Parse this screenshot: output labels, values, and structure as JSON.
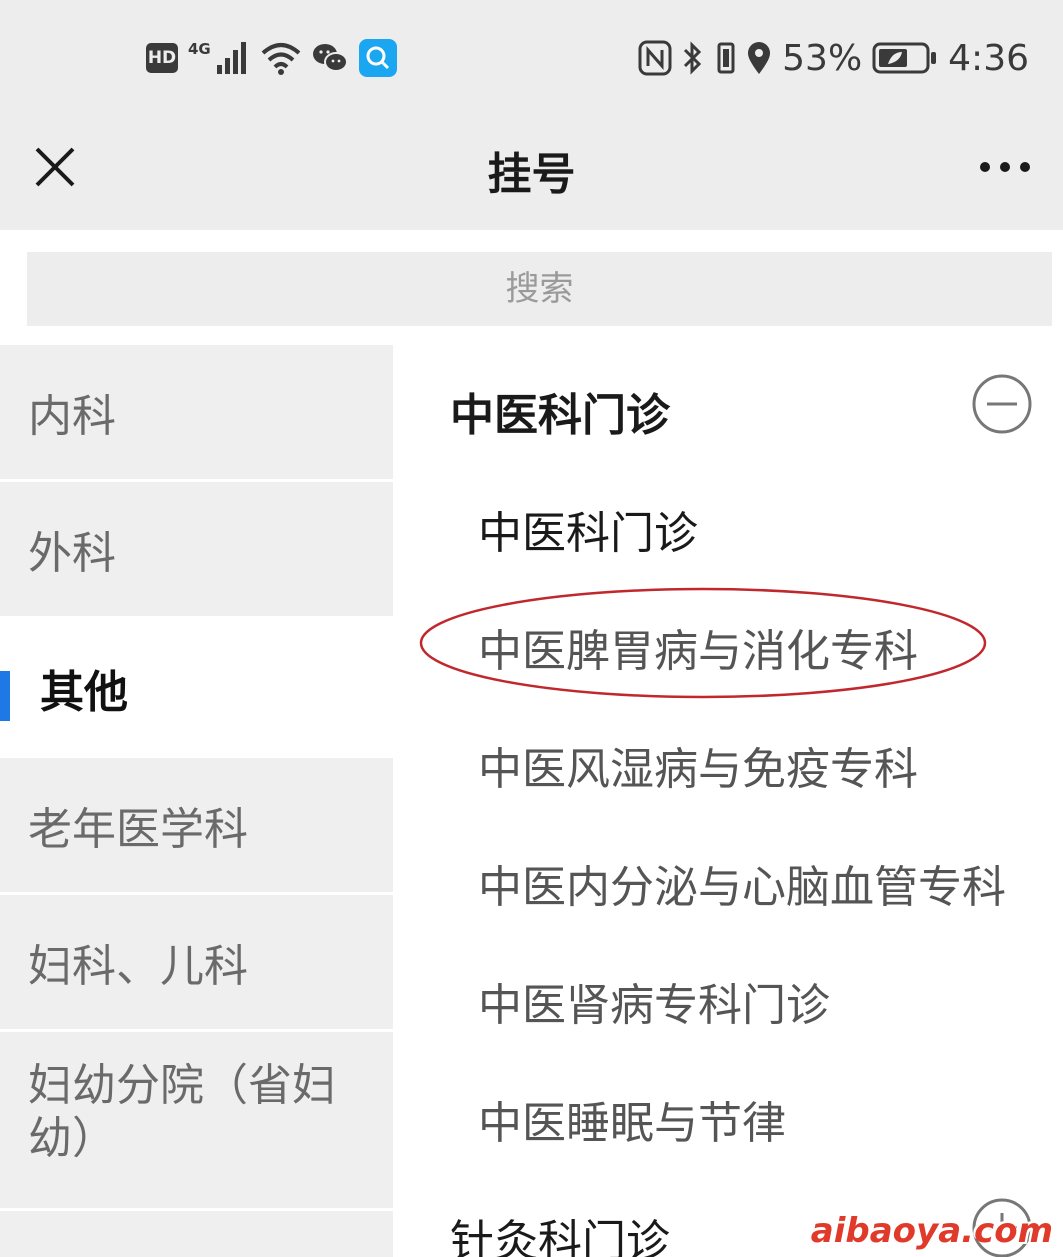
{
  "status_bar": {
    "hd_badge": "HD",
    "network_type": "4G",
    "battery_percent": "53%",
    "time": "4:36",
    "icons": [
      "hd-icon",
      "signal-icon",
      "wifi-icon",
      "wechat-icon",
      "search-app-icon",
      "nfc-icon",
      "bluetooth-icon",
      "vibrate-icon",
      "location-icon",
      "battery-icon"
    ]
  },
  "header": {
    "title": "挂号",
    "close_icon": "close-icon",
    "more_icon": "more-icon"
  },
  "search": {
    "placeholder": "搜索"
  },
  "sidebar": {
    "items": [
      {
        "label": "内科",
        "active": false
      },
      {
        "label": "外科",
        "active": false
      },
      {
        "label": "其他",
        "active": true
      },
      {
        "label": "老年医学科",
        "active": false
      },
      {
        "label": "妇科、儿科",
        "active": false
      },
      {
        "label": "妇幼分院（省妇幼）",
        "active": false
      }
    ],
    "active_color": "#1e78e6"
  },
  "content": {
    "groups": [
      {
        "title": "中医科门诊",
        "expanded": true,
        "toggle_icon": "minus-circle-icon",
        "items": [
          "中医科门诊",
          "中医脾胃病与消化专科",
          "中医风湿病与免疫专科",
          "中医内分泌与心脑血管专科",
          "中医肾病专科门诊",
          "中医睡眠与节律"
        ]
      },
      {
        "title": "针灸科门诊",
        "expanded": false,
        "toggle_icon": "plus-circle-icon",
        "items": []
      }
    ],
    "highlighted_item": "中医脾胃病与消化专科",
    "highlight_color": "#c0282d"
  },
  "watermark": "aibaoya.com"
}
